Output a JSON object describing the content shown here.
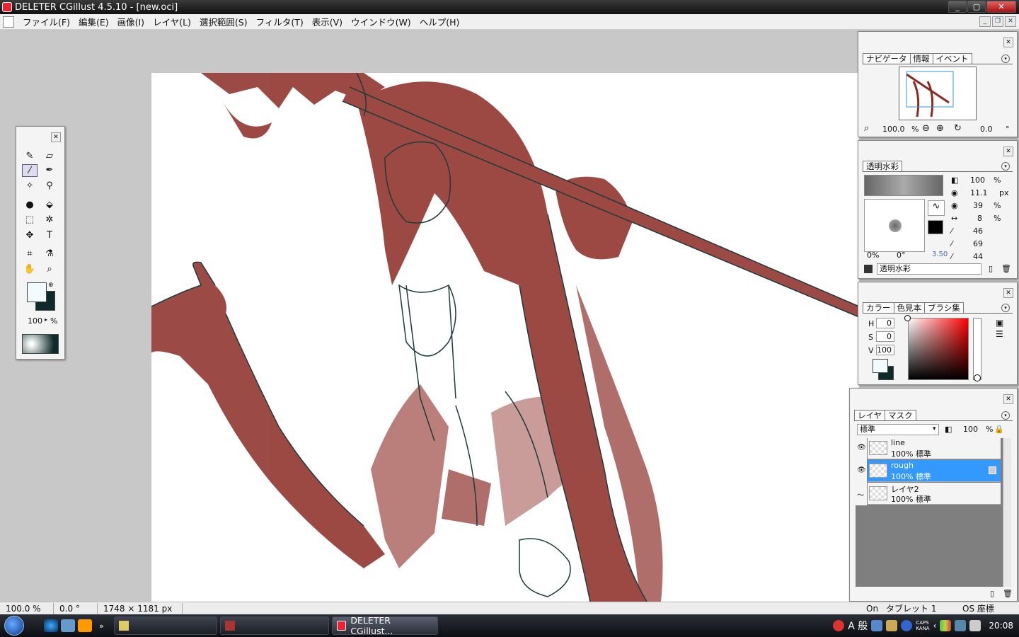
{
  "window": {
    "title": "DELETER CGillust 4.5.10 - [new.oci]",
    "controls": [
      "_",
      "▢",
      "✕"
    ]
  },
  "menu": [
    "ファイル(F)",
    "編集(E)",
    "画像(I)",
    "レイヤ(L)",
    "選択範囲(S)",
    "フィルタ(T)",
    "表示(V)",
    "ウインドウ(W)",
    "ヘルプ(H)"
  ],
  "mdi_controls": [
    "_",
    "❐",
    "✕"
  ],
  "toolbox": {
    "zoom_value": "100",
    "zoom_unit": "%"
  },
  "navigator": {
    "tabs": [
      "ナビゲータ",
      "情報",
      "イベント"
    ],
    "zoom": "100.0",
    "zoom_unit": "%",
    "angle": "0.0",
    "angle_unit": "°"
  },
  "brush": {
    "tab": "透明水彩",
    "opacity": "100",
    "opacity_unit": "%",
    "size": "11.1",
    "size_unit": "px",
    "density": "39",
    "density_unit": "%",
    "spacing": "8",
    "spacing_unit": "%",
    "p1": "46",
    "p2": "69",
    "p3": "44",
    "angle_pct": "0%",
    "angle_deg": "0°",
    "curve_val": "3.50",
    "preset_name": "透明水彩"
  },
  "color": {
    "tabs": [
      "カラー",
      "色見本",
      "ブラシ集"
    ],
    "h_label": "H",
    "h": "0",
    "s_label": "S",
    "s": "0",
    "v_label": "V",
    "v": "100",
    "hue_hex": "#ff0000"
  },
  "layers": {
    "tabs": [
      "レイヤ",
      "マスク"
    ],
    "blend_mode": "標準",
    "opacity": "100",
    "opacity_unit": "%",
    "items": [
      {
        "name": "line",
        "info": "100% 標準"
      },
      {
        "name": "rough",
        "info": "100% 標準"
      },
      {
        "name": "レイヤ2",
        "info": "100% 標準"
      }
    ]
  },
  "status": {
    "zoom": "100.0 %",
    "angle": "0.0 °",
    "size": "1748 × 1181 px",
    "on": "On",
    "tablet": "タブレット 1",
    "os": "OS 座標"
  },
  "taskbar": {
    "active_task": "DELETER CGillust...",
    "ime": "A 般",
    "caps": "CAPS",
    "kana": "KANA",
    "time": "20:08"
  },
  "colors": {
    "accent": "#3399ff",
    "ink": "#8b2a24",
    "line": "#1e3a3a"
  }
}
